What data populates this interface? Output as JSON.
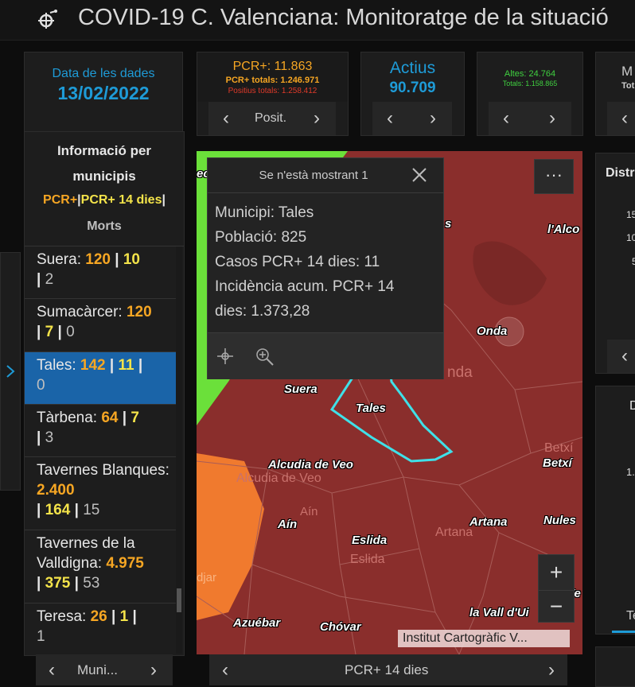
{
  "header": {
    "title": "COVID-19 C. Valenciana: Monitoratge de la situació",
    "icon": "virus-icon"
  },
  "cards": {
    "date": {
      "label": "Data de les dades",
      "value": "13/02/2022"
    },
    "pcr": {
      "main": "PCR+: 11.863",
      "totals": "PCR+ totals: 1.246.971",
      "positius": "Positius totals: 1.258.412",
      "nav_label": "Posit."
    },
    "actius": {
      "label": "Actius",
      "value": "90.709"
    },
    "altes": {
      "main": "Altes: 24.764",
      "totals": "Totals: 1.158.865"
    },
    "partial": {
      "line1": "M",
      "line2": "Tot"
    }
  },
  "list": {
    "title_line1": "Informació per",
    "title_line2": "municipis",
    "legend_pcr": "PCR+",
    "legend_sep": "|",
    "legend_pcr14": "PCR+ 14 dies",
    "legend_morts": "Morts",
    "nav_label": "Muni...",
    "items": [
      {
        "name": "Suera:",
        "pcr": "120",
        "pcr14": "10",
        "morts": "2"
      },
      {
        "name": "Sumacàrcer:",
        "pcr": "120",
        "pcr14": "7",
        "morts": "0"
      },
      {
        "name": "Tales:",
        "pcr": "142",
        "pcr14": "11",
        "morts": "0"
      },
      {
        "name": "Tàrbena:",
        "pcr": "64",
        "pcr14": "7",
        "morts": "3"
      },
      {
        "name": "Tavernes Blanques:",
        "pcr": "2.400",
        "pcr14": "164",
        "morts": "15"
      },
      {
        "name": "Tavernes de la Valldigna:",
        "pcr": "4.975",
        "pcr14": "375",
        "morts": "53"
      },
      {
        "name": "Teresa:",
        "pcr": "26",
        "pcr14": "1",
        "morts": "1"
      }
    ]
  },
  "popup": {
    "header": "Se n'està mostrant 1",
    "municipi": "Municipi: Tales",
    "poblacio": "Població: 825",
    "casos": "Casos PCR+ 14 dies: 11",
    "incidencia1": "Incidència acum. PCR+ 14",
    "incidencia2": "dies: 1.373,28"
  },
  "map": {
    "attribution": "Institut Cartogràfic V...",
    "nav_label": "PCR+ 14 dies",
    "zoom_in": "+",
    "zoom_out": "−",
    "menu": "···",
    "labels": {
      "s": "s",
      "lalco": "l'Alco",
      "onda": "Onda",
      "nda": "nda",
      "suera": "Suera",
      "tales": "Tales",
      "alcudia": "Alcudia de Veo",
      "alcudia_base": "Alcudia de Veo",
      "betxi": "Betxí",
      "betxi_base": "Betxí",
      "ain": "Aín",
      "ain_base": "Aín",
      "artana": "Artana",
      "artana_base": "Artana",
      "nules": "Nules",
      "eslida": "Eslida",
      "eslida_base": "Eslida",
      "azuebar": "Azuébar",
      "chovar": "Chóvar",
      "vall": "la Vall d'Ui",
      "ve": "Ve",
      "djar": "djar",
      "ec": "ec"
    }
  },
  "right": {
    "distr": "Distr",
    "n15": "15",
    "n10": "10",
    "n5": "5",
    "d": "D",
    "n1": "1.",
    "te": "Te"
  },
  "colors": {
    "accent": "#1e9bd7",
    "orange": "#f6a623",
    "yellow": "#f3e34a",
    "green": "#40d040",
    "selected": "#1a64a8"
  }
}
